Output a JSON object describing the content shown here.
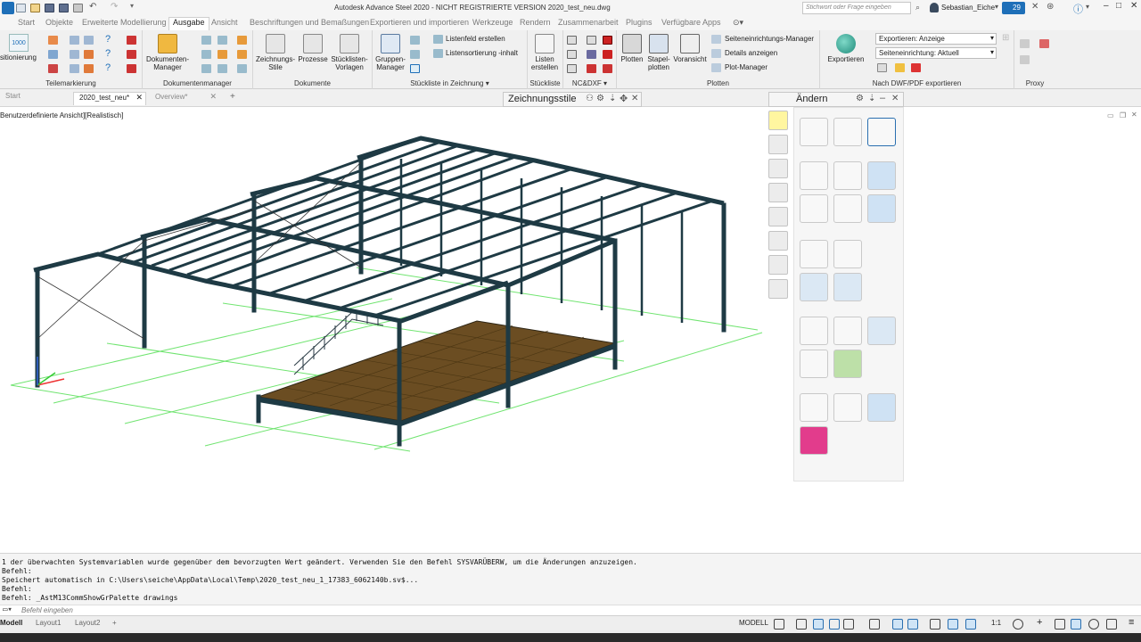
{
  "window": {
    "title": "Autodesk Advance Steel 2020 - NICHT REGISTRIERTE VERSION   2020_test_neu.dwg",
    "search_placeholder": "Stichwort oder Frage eingeben",
    "user": "Sebastian_Eiche",
    "badge_count": "29"
  },
  "menu": {
    "items": [
      "Start",
      "Objekte",
      "Erweiterte Modellierung",
      "Ausgabe",
      "Ansicht",
      "Beschriftungen und Bemaßungen",
      "Exportieren und importieren",
      "Werkzeuge",
      "Rendern",
      "Zusammenarbeit",
      "Plugins",
      "Verfügbare Apps"
    ],
    "active": "Ausgabe"
  },
  "ribbon": {
    "teilemarkierung": {
      "title": "Teilemarkierung",
      "btn": "sitionierung",
      "num": "1000"
    },
    "dokumentenmanager": {
      "title": "Dokumentenmanager",
      "btn1": "Dokumenten-",
      "btn2": "Manager"
    },
    "dokumente": {
      "title": "Dokumente",
      "zeichnungsstile1": "Zeichnungs-",
      "zeichnungsstile2": "Stile",
      "prozesse": "Prozesse",
      "stuecklisten1": "Stücklisten-",
      "stuecklisten2": "Vorlagen"
    },
    "stueckliste_zeichnung": {
      "title": "Stückliste in Zeichnung",
      "gruppen1": "Gruppen-",
      "gruppen2": "Manager",
      "listenfeld": "Listenfeld erstellen",
      "listensortierung": "Listensortierung -inhalt"
    },
    "stueckliste": {
      "title": "Stückliste",
      "listen1": "Listen",
      "listen2": "erstellen"
    },
    "ncdxf": {
      "title": "NC&DXF"
    },
    "plotten": {
      "title": "Plotten",
      "plotten": "Plotten",
      "stapel1": "Stapel-",
      "stapel2": "plotten",
      "voransicht": "Voransicht",
      "seiteneinrichtung": "Seiteneinrichtungs-Manager",
      "details": "Details anzeigen",
      "plotmanager": "Plot-Manager"
    },
    "dwgpdf": {
      "title": "Nach DWF/PDF exportieren",
      "exportieren": "Exportieren",
      "combo1": "Exportieren: Anzeige",
      "combo2": "Seiteneinrichtung: Aktuell"
    },
    "proxy": {
      "title": "Proxy"
    }
  },
  "doctabs": [
    "Start",
    "2020_test_neu*",
    "Overview*"
  ],
  "viewport": {
    "label": "Benutzerdefinierte Ansicht][Realistisch]"
  },
  "palettes": {
    "zeichnungsstile": "Zeichnungsstile",
    "aendern": "Ändern"
  },
  "command": {
    "lines": [
      "1 der überwachten Systemvariablen wurde gegenüber dem bevorzugten Wert geändert. Verwenden Sie den Befehl SYSVARÜBERW, um die Änderungen anzuzeigen.",
      "Befehl:",
      "Speichert automatisch in C:\\Users\\seiche\\AppData\\Local\\Temp\\2020_test_neu_1_17383_6062140b.sv$...",
      "Befehl:",
      "Befehl: _AstM13CommShowGrPalette drawings"
    ],
    "placeholder": "Befehl eingeben"
  },
  "status": {
    "tabs": [
      "Modell",
      "Layout1",
      "Layout2"
    ],
    "modell": "MODELL",
    "scale": "1:1"
  },
  "colors": {
    "accent": "#1e6fb8",
    "steel": "#1e3a44",
    "grid": "#58e058",
    "floor": "#6b4d22"
  }
}
